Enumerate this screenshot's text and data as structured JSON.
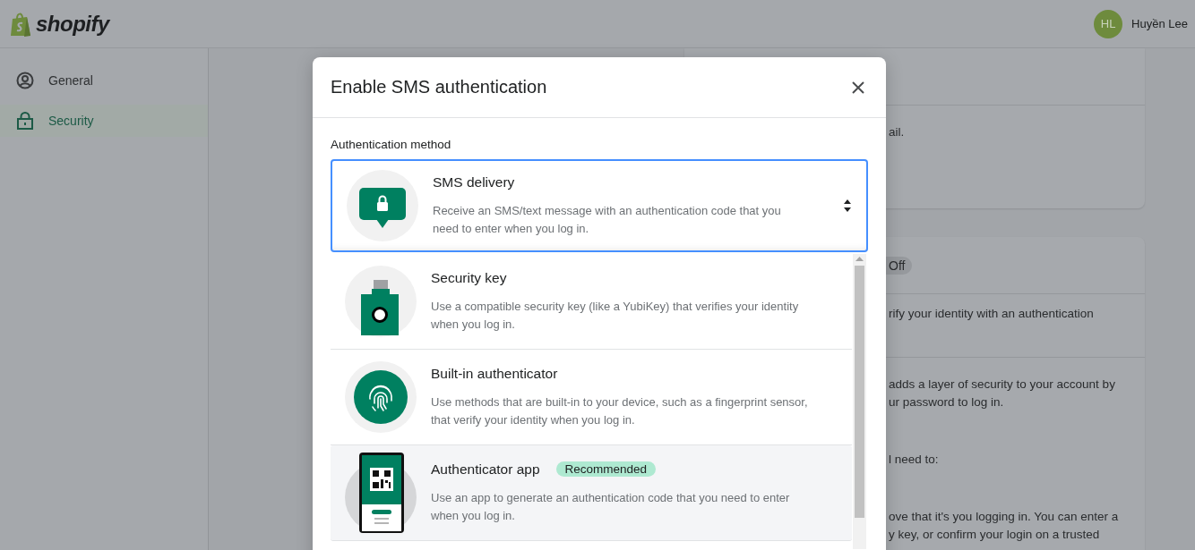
{
  "header": {
    "logo_text": "shopify",
    "user": {
      "initials": "HL",
      "name": "Huyền Lee"
    }
  },
  "sidebar": {
    "items": [
      {
        "label": "General",
        "kind": "person",
        "selected": false
      },
      {
        "label": "Security",
        "kind": "lock",
        "selected": true
      }
    ]
  },
  "cards": [
    {
      "sections": [
        {
          "lines": [
            "ail."
          ]
        }
      ]
    },
    {
      "status_badge": "Off",
      "sections": [
        {
          "lines": [
            "rify your identity with an authentication"
          ]
        },
        {
          "paragraphs": [
            [
              "adds a layer of security to your account by",
              "ur password to log in."
            ],
            [
              "l need to:"
            ],
            [
              "ove that it's you logging in. You can enter a",
              "y key, or confirm your login on a trusted"
            ]
          ]
        }
      ]
    }
  ],
  "modal": {
    "title": "Enable SMS authentication",
    "field_label": "Authentication method",
    "selected_option": {
      "kind": "sms",
      "title": "SMS delivery",
      "description": "Receive an SMS/text message with an authentication code that you need to enter when you log in."
    },
    "options": [
      {
        "kind": "key",
        "title": "Security key",
        "description": "Use a compatible security key (like a YubiKey) that verifies your identity when you log in.",
        "highlighted": false
      },
      {
        "kind": "fingerprint",
        "title": "Built-in authenticator",
        "description": "Use methods that are built-in to your device, such as a fingerprint sensor, that verify your identity when you log in.",
        "highlighted": false
      },
      {
        "kind": "app",
        "title": "Authenticator app",
        "badge": "Recommended",
        "description": "Use an app to generate an authentication code that you need to enter when you log in.",
        "highlighted": true
      }
    ]
  }
}
